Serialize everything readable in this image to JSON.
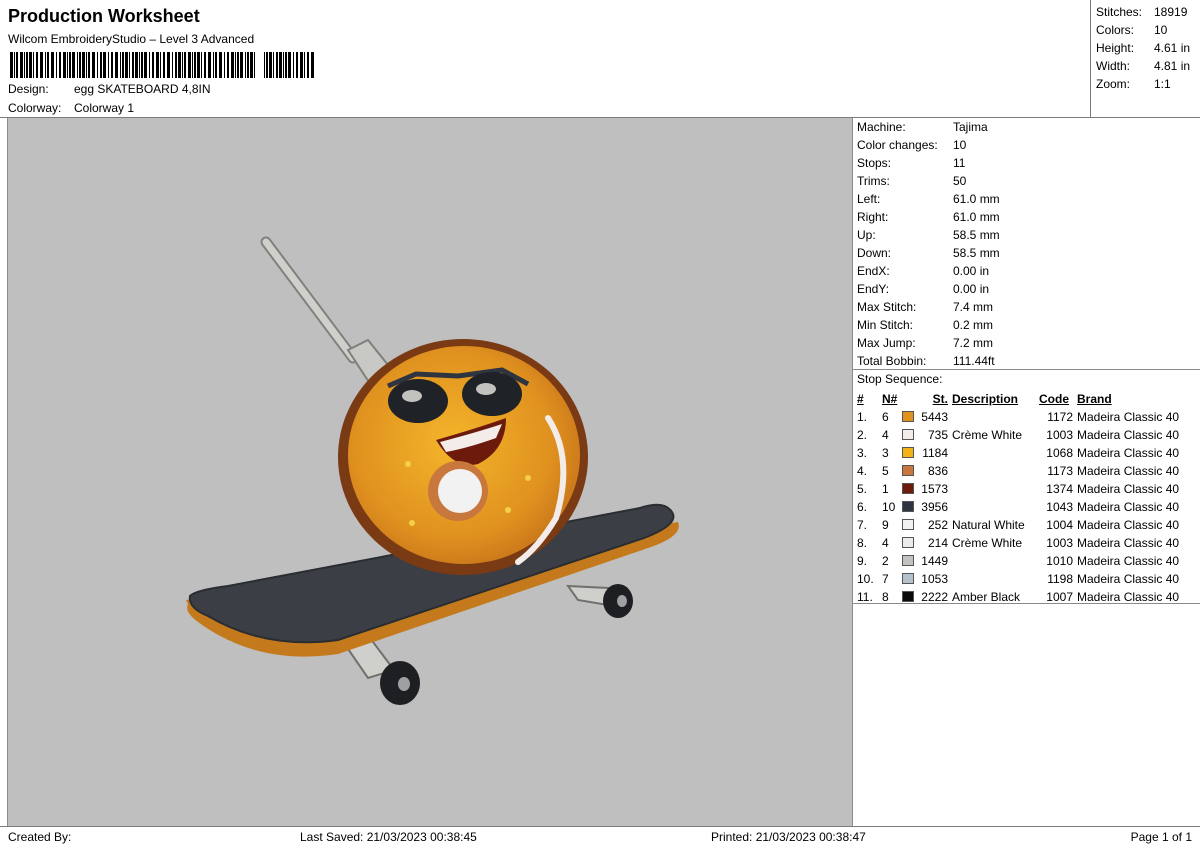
{
  "header": {
    "title": "Production Worksheet",
    "software": "Wilcom EmbroideryStudio – Level 3 Advanced",
    "design_label": "Design:",
    "design_value": "egg SKATEBOARD 4,8IN",
    "colorway_label": "Colorway:",
    "colorway_value": "Colorway 1"
  },
  "stats": [
    {
      "label": "Stitches:",
      "value": "18919"
    },
    {
      "label": "Colors:",
      "value": "10"
    },
    {
      "label": "Height:",
      "value": "4.61 in"
    },
    {
      "label": "Width:",
      "value": "4.81 in"
    },
    {
      "label": "Zoom:",
      "value": "1:1"
    }
  ],
  "machine": [
    {
      "label": "Machine:",
      "value": "Tajima"
    },
    {
      "label": "Color changes:",
      "value": "10"
    },
    {
      "label": "Stops:",
      "value": "11"
    },
    {
      "label": "Trims:",
      "value": "50"
    },
    {
      "label": "Left:",
      "value": "61.0 mm"
    },
    {
      "label": "Right:",
      "value": "61.0 mm"
    },
    {
      "label": "Up:",
      "value": "58.5 mm"
    },
    {
      "label": "Down:",
      "value": "58.5 mm"
    },
    {
      "label": "EndX:",
      "value": "0.00 in"
    },
    {
      "label": "EndY:",
      "value": "0.00 in"
    },
    {
      "label": "Max Stitch:",
      "value": "7.4 mm"
    },
    {
      "label": "Min Stitch:",
      "value": "0.2 mm"
    },
    {
      "label": "Max Jump:",
      "value": "7.2 mm"
    },
    {
      "label": "Total Bobbin:",
      "value": "111.44ft"
    }
  ],
  "stop_sequence": {
    "title": "Stop Sequence:",
    "columns": [
      "#",
      "N#",
      "St.",
      "Description",
      "Code",
      "Brand"
    ],
    "rows": [
      {
        "idx": "1.",
        "n": "6",
        "color": "#e0921f",
        "st": "5443",
        "desc": "",
        "code": "1172",
        "brand": "Madeira Classic 40"
      },
      {
        "idx": "2.",
        "n": "4",
        "color": "#f4ece8",
        "st": "735",
        "desc": "Crème White",
        "code": "1003",
        "brand": "Madeira Classic 40"
      },
      {
        "idx": "3.",
        "n": "3",
        "color": "#f3b318",
        "st": "1184",
        "desc": "",
        "code": "1068",
        "brand": "Madeira Classic 40"
      },
      {
        "idx": "4.",
        "n": "5",
        "color": "#c8783c",
        "st": "836",
        "desc": "",
        "code": "1173",
        "brand": "Madeira Classic 40"
      },
      {
        "idx": "5.",
        "n": "1",
        "color": "#6b1a0c",
        "st": "1573",
        "desc": "",
        "code": "1374",
        "brand": "Madeira Classic 40"
      },
      {
        "idx": "6.",
        "n": "10",
        "color": "#2e3440",
        "st": "3956",
        "desc": "",
        "code": "1043",
        "brand": "Madeira Classic 40"
      },
      {
        "idx": "7.",
        "n": "9",
        "color": "#f2f2f2",
        "st": "252",
        "desc": "Natural White",
        "code": "1004",
        "brand": "Madeira Classic 40"
      },
      {
        "idx": "8.",
        "n": "4",
        "color": "#ebebeb",
        "st": "214",
        "desc": "Crème White",
        "code": "1003",
        "brand": "Madeira Classic 40"
      },
      {
        "idx": "9.",
        "n": "2",
        "color": "#c2c2be",
        "st": "1449",
        "desc": "",
        "code": "1010",
        "brand": "Madeira Classic 40"
      },
      {
        "idx": "10.",
        "n": "7",
        "color": "#b4c2cc",
        "st": "1053",
        "desc": "",
        "code": "1198",
        "brand": "Madeira Classic 40"
      },
      {
        "idx": "11.",
        "n": "8",
        "color": "#0a0a0a",
        "st": "2222",
        "desc": "Amber Black",
        "code": "1007",
        "brand": "Madeira Classic 40"
      }
    ]
  },
  "footer": {
    "created_by": "Created By:",
    "last_saved": "Last Saved: 21/03/2023 00:38:45",
    "printed": "Printed: 21/03/2023 00:38:47",
    "page": "Page 1 of 1"
  }
}
